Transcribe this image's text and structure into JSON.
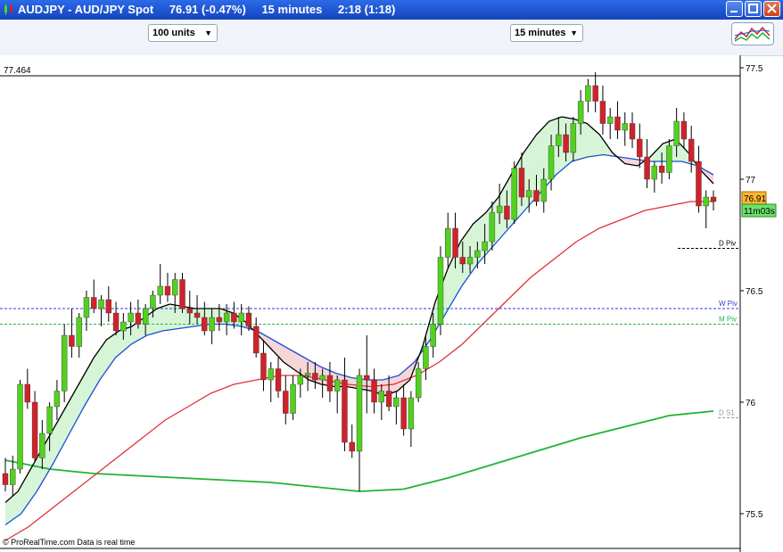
{
  "window": {
    "instrument": "AUDJPY - AUD/JPY Spot",
    "price": "76.91 (-0.47%)",
    "timeframe": "15 minutes",
    "time": "2:18 (1:18)"
  },
  "toolbar": {
    "units_value": "100 units",
    "timeframe_value": "15 minutes"
  },
  "footer": {
    "text": "© ProRealTime.com  Data is real time"
  },
  "colors": {
    "bullish": "#52d11e",
    "bearish": "#d0222a",
    "ema_fast": "#000000",
    "ema_mid": "#1a4fd6",
    "ema_slow": "#e0303a",
    "ema_long": "#21b335",
    "fill_up": "#d6f5d6",
    "fill_down": "#f6d6d8"
  },
  "chart_data": {
    "type": "candlestick",
    "title": "AUDJPY - AUD/JPY Spot",
    "y_ticks": [
      75.5,
      75.5,
      76,
      76.5,
      77,
      77.5
    ],
    "y_tick_labels": [
      "75.5",
      "76",
      "76.5",
      "77",
      "77.5"
    ],
    "ylim": [
      75.35,
      77.55
    ],
    "top_value_label": "77.464",
    "last_price": "76.91",
    "countdown": "11m03s",
    "levels": [
      {
        "name": "D Piv",
        "value": 76.69,
        "color": "#000000"
      },
      {
        "name": "W Piv",
        "value": 76.42,
        "color": "#3a3ad8"
      },
      {
        "name": "M Piv",
        "value": 76.35,
        "color": "#27b54a"
      },
      {
        "name": "D S1",
        "value": 75.93,
        "color": "#999999"
      }
    ],
    "candles": [
      [
        75.68,
        75.75,
        75.6,
        75.63
      ],
      [
        75.63,
        75.76,
        75.58,
        75.7
      ],
      [
        75.7,
        76.1,
        75.68,
        76.08
      ],
      [
        76.08,
        76.15,
        75.97,
        76.0
      ],
      [
        76.0,
        76.05,
        75.73,
        75.75
      ],
      [
        75.75,
        75.92,
        75.7,
        75.86
      ],
      [
        75.86,
        76.0,
        75.78,
        75.98
      ],
      [
        75.98,
        76.1,
        75.92,
        76.05
      ],
      [
        76.05,
        76.35,
        76.0,
        76.3
      ],
      [
        76.3,
        76.42,
        76.2,
        76.25
      ],
      [
        76.25,
        76.4,
        76.2,
        76.38
      ],
      [
        76.38,
        76.5,
        76.32,
        76.47
      ],
      [
        76.47,
        76.55,
        76.4,
        76.42
      ],
      [
        76.42,
        76.48,
        76.34,
        76.46
      ],
      [
        76.46,
        76.52,
        76.36,
        76.4
      ],
      [
        76.4,
        76.45,
        76.3,
        76.32
      ],
      [
        76.32,
        76.4,
        76.28,
        76.36
      ],
      [
        76.36,
        76.45,
        76.3,
        76.4
      ],
      [
        76.4,
        76.46,
        76.33,
        76.35
      ],
      [
        76.35,
        76.44,
        76.3,
        76.42
      ],
      [
        76.42,
        76.5,
        76.38,
        76.48
      ],
      [
        76.48,
        76.62,
        76.44,
        76.52
      ],
      [
        76.52,
        76.58,
        76.45,
        76.48
      ],
      [
        76.48,
        76.58,
        76.4,
        76.55
      ],
      [
        76.55,
        76.58,
        76.4,
        76.42
      ],
      [
        76.42,
        76.5,
        76.35,
        76.4
      ],
      [
        76.4,
        76.48,
        76.35,
        76.38
      ],
      [
        76.38,
        76.45,
        76.3,
        76.32
      ],
      [
        76.32,
        76.42,
        76.26,
        76.38
      ],
      [
        76.38,
        76.44,
        76.32,
        76.36
      ],
      [
        76.36,
        76.44,
        76.3,
        76.4
      ],
      [
        76.4,
        76.45,
        76.33,
        76.36
      ],
      [
        76.36,
        76.44,
        76.3,
        76.4
      ],
      [
        76.4,
        76.43,
        76.32,
        76.34
      ],
      [
        76.34,
        76.38,
        76.2,
        76.22
      ],
      [
        76.22,
        76.28,
        76.05,
        76.1
      ],
      [
        76.1,
        76.18,
        76.0,
        76.15
      ],
      [
        76.15,
        76.2,
        76.02,
        76.05
      ],
      [
        76.05,
        76.12,
        75.9,
        75.95
      ],
      [
        75.95,
        76.12,
        75.92,
        76.08
      ],
      [
        76.08,
        76.15,
        76.02,
        76.12
      ],
      [
        76.12,
        76.18,
        76.05,
        76.13
      ],
      [
        76.13,
        76.18,
        76.06,
        76.1
      ],
      [
        76.1,
        76.15,
        76.02,
        76.12
      ],
      [
        76.12,
        76.18,
        76.0,
        76.05
      ],
      [
        76.05,
        76.12,
        75.95,
        76.1
      ],
      [
        76.1,
        76.2,
        75.78,
        75.82
      ],
      [
        75.82,
        75.9,
        75.75,
        75.78
      ],
      [
        75.78,
        76.15,
        75.6,
        76.12
      ],
      [
        76.12,
        76.3,
        75.95,
        76.1
      ],
      [
        76.1,
        76.15,
        75.95,
        76.0
      ],
      [
        76.0,
        76.08,
        75.92,
        76.05
      ],
      [
        76.05,
        76.12,
        75.96,
        75.98
      ],
      [
        75.98,
        76.05,
        75.9,
        76.02
      ],
      [
        76.02,
        76.08,
        75.85,
        75.88
      ],
      [
        75.88,
        76.05,
        75.8,
        76.02
      ],
      [
        76.02,
        76.18,
        76.0,
        76.15
      ],
      [
        76.15,
        76.3,
        76.1,
        76.25
      ],
      [
        76.25,
        76.4,
        76.2,
        76.35
      ],
      [
        76.35,
        76.7,
        76.3,
        76.65
      ],
      [
        76.65,
        76.85,
        76.6,
        76.78
      ],
      [
        76.78,
        76.85,
        76.6,
        76.65
      ],
      [
        76.65,
        76.72,
        76.58,
        76.62
      ],
      [
        76.62,
        76.7,
        76.58,
        76.65
      ],
      [
        76.65,
        76.72,
        76.6,
        76.68
      ],
      [
        76.68,
        76.8,
        76.62,
        76.72
      ],
      [
        76.72,
        76.9,
        76.68,
        76.85
      ],
      [
        76.85,
        76.98,
        76.8,
        76.88
      ],
      [
        76.88,
        76.95,
        76.78,
        76.82
      ],
      [
        76.82,
        77.08,
        76.8,
        77.05
      ],
      [
        77.05,
        77.12,
        76.88,
        76.92
      ],
      [
        76.92,
        77.0,
        76.85,
        76.95
      ],
      [
        76.95,
        77.02,
        76.88,
        76.9
      ],
      [
        76.9,
        77.05,
        76.85,
        77.0
      ],
      [
        77.0,
        77.2,
        76.95,
        77.15
      ],
      [
        77.15,
        77.28,
        77.1,
        77.2
      ],
      [
        77.2,
        77.25,
        77.08,
        77.12
      ],
      [
        77.12,
        77.28,
        77.08,
        77.25
      ],
      [
        77.25,
        77.4,
        77.2,
        77.35
      ],
      [
        77.35,
        77.45,
        77.3,
        77.42
      ],
      [
        77.42,
        77.48,
        77.3,
        77.35
      ],
      [
        77.35,
        77.42,
        77.2,
        77.25
      ],
      [
        77.25,
        77.32,
        77.18,
        77.28
      ],
      [
        77.28,
        77.35,
        77.18,
        77.22
      ],
      [
        77.22,
        77.3,
        77.15,
        77.25
      ],
      [
        77.25,
        77.3,
        77.14,
        77.18
      ],
      [
        77.18,
        77.25,
        77.05,
        77.1
      ],
      [
        77.1,
        77.18,
        76.96,
        77.0
      ],
      [
        77.0,
        77.08,
        76.94,
        77.06
      ],
      [
        77.06,
        77.12,
        76.98,
        77.03
      ],
      [
        77.03,
        77.18,
        77.0,
        77.15
      ],
      [
        77.15,
        77.32,
        77.1,
        77.26
      ],
      [
        77.26,
        77.3,
        77.14,
        77.18
      ],
      [
        77.18,
        77.24,
        77.03,
        77.08
      ],
      [
        77.08,
        77.15,
        76.85,
        76.88
      ],
      [
        76.88,
        76.95,
        76.78,
        76.92
      ],
      [
        76.92,
        76.95,
        76.86,
        76.9
      ]
    ],
    "ema_fast": [
      75.55,
      75.6,
      75.7,
      75.8,
      75.9,
      76.0,
      76.1,
      76.2,
      76.28,
      76.32,
      76.34,
      76.38,
      76.42,
      76.44,
      76.43,
      76.42,
      76.42,
      76.42,
      76.4,
      76.36,
      76.3,
      76.24,
      76.18,
      76.14,
      76.1,
      76.08,
      76.07,
      76.07,
      76.06,
      76.05,
      76.03,
      76.05,
      76.1,
      76.25,
      76.45,
      76.6,
      76.72,
      76.8,
      76.85,
      76.92,
      77.02,
      77.12,
      77.2,
      77.26,
      77.28,
      77.27,
      77.25,
      77.2,
      77.12,
      77.07,
      77.06,
      77.1,
      77.16,
      77.18,
      77.12,
      77.04,
      76.98
    ],
    "ema_mid": [
      75.45,
      75.5,
      75.6,
      75.72,
      75.85,
      75.98,
      76.1,
      76.2,
      76.26,
      76.3,
      76.32,
      76.33,
      76.34,
      76.35,
      76.35,
      76.34,
      76.32,
      76.28,
      76.24,
      76.2,
      76.16,
      76.13,
      76.11,
      76.1,
      76.1,
      76.12,
      76.18,
      76.28,
      76.4,
      76.52,
      76.62,
      76.7,
      76.78,
      76.86,
      76.94,
      77.02,
      77.08,
      77.1,
      77.11,
      77.1,
      77.09,
      77.08,
      77.08,
      77.08,
      77.06,
      77.02
    ],
    "ema_slow": [
      75.38,
      75.44,
      75.52,
      75.6,
      75.68,
      75.76,
      75.84,
      75.92,
      75.98,
      76.04,
      76.08,
      76.1,
      76.12,
      76.12,
      76.1,
      76.08,
      76.07,
      76.08,
      76.12,
      76.18,
      76.26,
      76.36,
      76.46,
      76.56,
      76.64,
      76.72,
      76.78,
      76.82,
      76.86,
      76.88,
      76.9,
      76.9
    ],
    "ema_long": [
      75.74,
      75.7,
      75.68,
      75.67,
      75.66,
      75.65,
      75.64,
      75.62,
      75.6,
      75.61,
      75.66,
      75.72,
      75.78,
      75.84,
      75.89,
      75.94,
      75.96
    ]
  }
}
